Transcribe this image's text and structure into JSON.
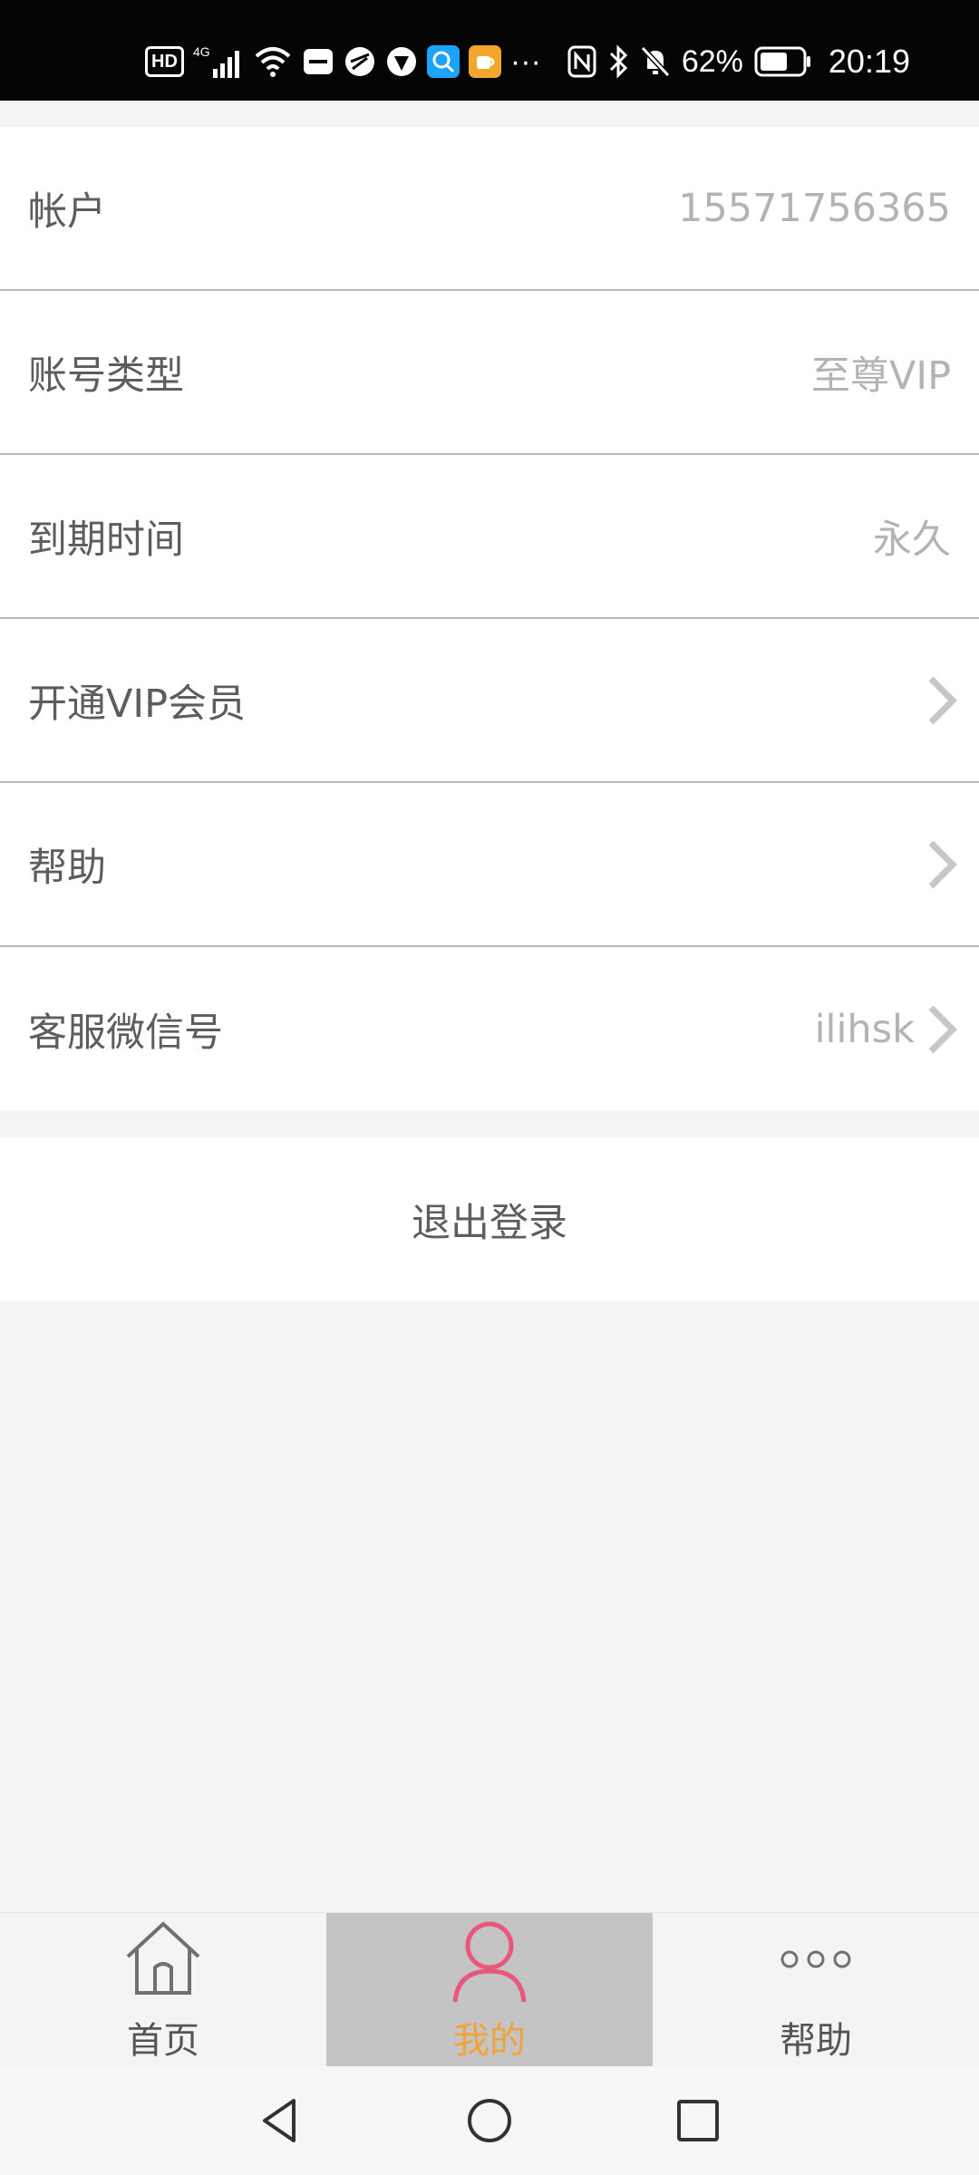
{
  "status_bar": {
    "hd": "HD",
    "network": "4G",
    "more": "···",
    "battery": "62%",
    "time": "20:19",
    "icons": [
      "hd-icon",
      "signal-icon",
      "wifi-icon",
      "huawei-icon",
      "app-icon",
      "app-icon",
      "search-app-icon",
      "cup-app-icon",
      "nfc-icon",
      "bluetooth-icon",
      "mute-icon",
      "battery-icon"
    ]
  },
  "account": {
    "rows": [
      {
        "label": "帐户",
        "value": "15571756365"
      },
      {
        "label": "账号类型",
        "value": "至尊VIP"
      },
      {
        "label": "到期时间",
        "value": "永久"
      },
      {
        "label": "开通VIP会员",
        "value": ""
      },
      {
        "label": "帮助",
        "value": ""
      },
      {
        "label": "客服微信号",
        "value": "ilihsk"
      }
    ]
  },
  "logout": {
    "label": "退出登录"
  },
  "tabs": [
    {
      "label": "首页",
      "icon": "home-icon"
    },
    {
      "label": "我的",
      "icon": "person-icon"
    },
    {
      "label": "帮助",
      "icon": "more-dots-icon"
    }
  ],
  "colors": {
    "accent": "#f2a23a",
    "active_icon": "#e8587a",
    "active_tab_bg": "#c4c4c4"
  },
  "nav": {
    "icons": [
      "back-icon",
      "home-circle-icon",
      "recents-icon"
    ]
  }
}
